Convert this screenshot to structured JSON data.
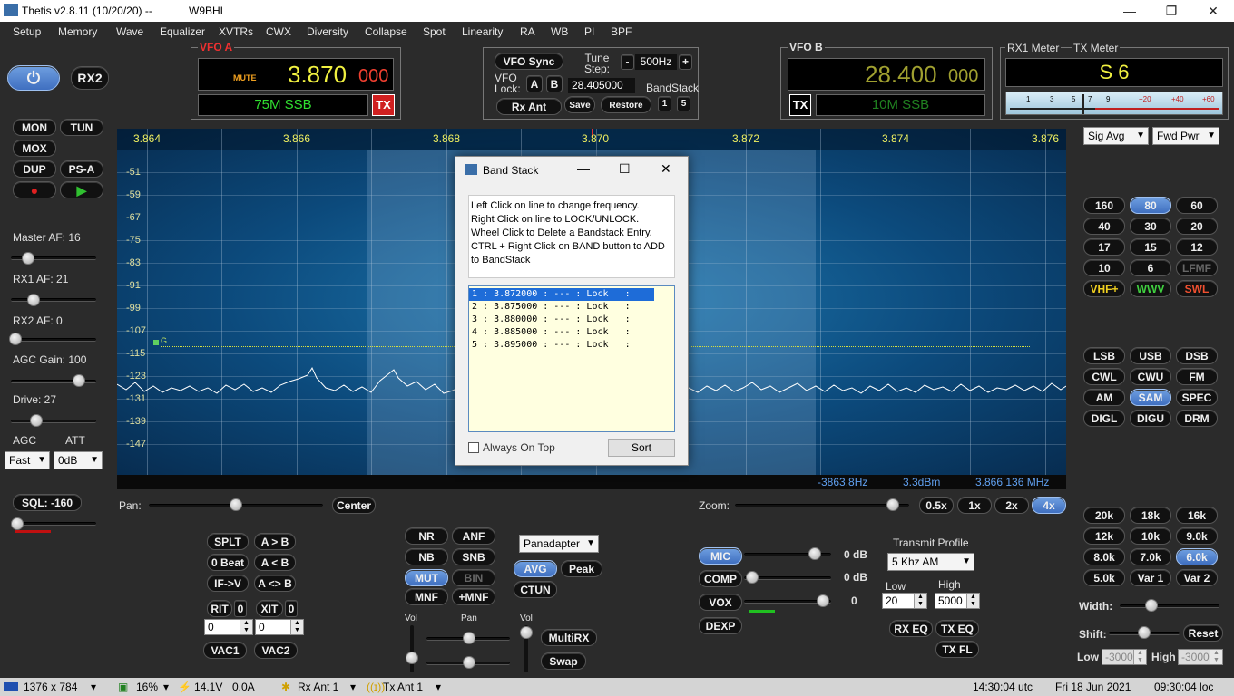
{
  "window": {
    "title": "Thetis v2.8.11 (10/20/20)   --",
    "callsign": "W9BHI"
  },
  "menu": [
    "Setup",
    "Memory",
    "Wave",
    "Equalizer",
    "XVTRs",
    "CWX",
    "Diversity",
    "Collapse",
    "Spot",
    "Linearity",
    "RA",
    "WB",
    "PI",
    "BPF"
  ],
  "vfoa": {
    "label": "VFO A",
    "mute": "MUTE",
    "freq": "3.870",
    "freq_sub": "000",
    "mode": "75M SSB",
    "tx": "TX"
  },
  "vfob": {
    "label": "VFO B",
    "freq": "28.400",
    "freq_sub": "000",
    "mode": "10M SSB",
    "tx": "TX"
  },
  "center": {
    "vfo_sync": "VFO Sync",
    "tune_step_label": "Tune Step:",
    "tune_step": "500Hz",
    "minus": "-",
    "plus": "+",
    "vfo_lock": "VFO Lock:",
    "a": "A",
    "b": "B",
    "freq_entry": "28.405000",
    "bandstack": "BandStack",
    "rx_ant": "Rx Ant",
    "save": "Save",
    "restore": "Restore",
    "bs1": "1",
    "bs5": "5"
  },
  "meters": {
    "rx1": "RX1 Meter",
    "tx": "TX Meter",
    "reading": "S 6",
    "scale": [
      "1",
      "3",
      "5",
      "7",
      "9",
      "+20",
      "+40",
      "+60"
    ],
    "rx_sel": "Sig Avg",
    "tx_sel": "Fwd Pwr"
  },
  "left": {
    "power": "⏻",
    "rx2": "RX2",
    "mon": "MON",
    "tun": "TUN",
    "mox": "MOX",
    "dup": "DUP",
    "psa": "PS-A",
    "master_af": "Master AF:  16",
    "rx1_af": "RX1 AF:  21",
    "rx2_af": "RX2 AF:  0",
    "agc_gain": "AGC Gain:  100",
    "drive": "Drive:  27",
    "agc": "AGC",
    "att": "ATT",
    "agc_sel": "Fast",
    "att_sel": "0dB",
    "sql": "SQL: -160"
  },
  "display": {
    "freq_ticks": [
      "3.864",
      "3.866",
      "3.868",
      "3.870",
      "3.872",
      "3.874",
      "3.876"
    ],
    "db_ticks": [
      "-51",
      "-59",
      "-67",
      "-75",
      "-83",
      "-91",
      "-99",
      "-107",
      "-115",
      "-123",
      "-131",
      "-139",
      "-147"
    ],
    "marker": "G",
    "readout_hz": "-3863.8Hz",
    "readout_dbm": "3.3dBm",
    "readout_mhz": "3.866 136 MHz"
  },
  "dialog": {
    "title": "Band Stack",
    "help": "Left Click on line to change frequency.\nRight Click on line to LOCK/UNLOCK.\nWheel Click to Delete a Bandstack Entry.\nCTRL + Right Click on BAND button to ADD to BandStack",
    "entries": [
      "1 : 3.872000 : --- : Lock   :",
      "2 : 3.875000 : --- : Lock   :",
      "3 : 3.880000 : --- : Lock   :",
      "4 : 3.885000 : --- : Lock   :",
      "5 : 3.895000 : --- : Lock   :"
    ],
    "always_on_top": "Always On Top",
    "sort": "Sort"
  },
  "bands": [
    "160",
    "80",
    "60",
    "40",
    "30",
    "20",
    "17",
    "15",
    "12",
    "10",
    "6",
    "LFMF",
    "VHF+",
    "WWV",
    "SWL"
  ],
  "modes": [
    "LSB",
    "USB",
    "DSB",
    "CWL",
    "CWU",
    "FM",
    "AM",
    "SAM",
    "SPEC",
    "DIGL",
    "DIGU",
    "DRM"
  ],
  "filters": [
    "20k",
    "18k",
    "16k",
    "12k",
    "10k",
    "9.0k",
    "8.0k",
    "7.0k",
    "6.0k",
    "5.0k",
    "Var 1",
    "Var 2"
  ],
  "filter_ctrl": {
    "width": "Width:",
    "shift": "Shift:",
    "reset": "Reset",
    "low": "Low",
    "high": "High",
    "low_val": "-3000",
    "high_val": "-3000"
  },
  "pan": {
    "label": "Pan:",
    "center": "Center",
    "zoom": "Zoom:",
    "z05": "0.5x",
    "z1": "1x",
    "z2": "2x",
    "z4": "4x"
  },
  "bottom_left": {
    "splt": "SPLT",
    "a_b": "A > B",
    "beat": "0 Beat",
    "b_a": "A < B",
    "ifv": "IF->V",
    "swap": "A <> B",
    "rit": "RIT",
    "rit_v": "0",
    "xit": "XIT",
    "xit_v": "0",
    "rit_spin": "0",
    "xit_spin": "0",
    "vac1": "VAC1",
    "vac2": "VAC2"
  },
  "dsp": {
    "nr": "NR",
    "anf": "ANF",
    "nb": "NB",
    "snb": "SNB",
    "mut": "MUT",
    "bin": "BIN",
    "mnf": "MNF",
    "pmnf": "+MNF",
    "display_sel": "Panadapter",
    "avg": "AVG",
    "peak": "Peak",
    "ctun": "CTUN",
    "vol": "Vol",
    "pan": "Pan",
    "vol2": "Vol",
    "multirx": "MultiRX",
    "swap": "Swap"
  },
  "tx": {
    "mic": "MIC",
    "mic_db": "0 dB",
    "comp": "COMP",
    "comp_db": "0 dB",
    "vox": "VOX",
    "vox_v": "0",
    "dexp": "DEXP",
    "profile_label": "Transmit Profile",
    "profile": "5 Khz AM",
    "low": "Low",
    "high": "High",
    "low_v": "20",
    "high_v": "5000",
    "rxeq": "RX EQ",
    "txeq": "TX EQ",
    "txfl": "TX FL"
  },
  "status": {
    "res": "1376 x 784",
    "cpu": "16%",
    "volt": "14.1V",
    "amp": "0.0A",
    "rxant": "Rx Ant  1",
    "txant": "Tx Ant  1",
    "utc": "14:30:04 utc",
    "date": "Fri 18 Jun 2021",
    "loc": "09:30:04 loc"
  }
}
